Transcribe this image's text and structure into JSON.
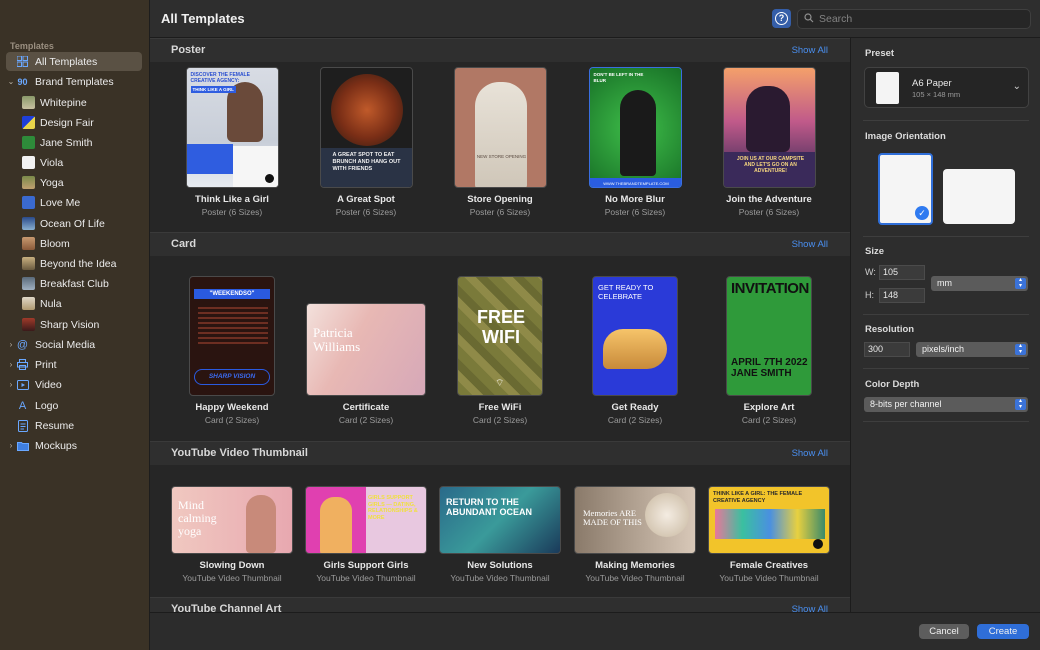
{
  "sidebar": {
    "group_header": "Templates",
    "items": [
      {
        "label": "All Templates",
        "icon": "grid-icon"
      },
      {
        "label": "Brand Templates",
        "icon": "brand-icon"
      },
      {
        "label": "Whitepine"
      },
      {
        "label": "Design Fair"
      },
      {
        "label": "Jane Smith"
      },
      {
        "label": "Viola"
      },
      {
        "label": "Yoga"
      },
      {
        "label": "Love Me"
      },
      {
        "label": "Ocean Of Life"
      },
      {
        "label": "Bloom"
      },
      {
        "label": "Beyond the Idea"
      },
      {
        "label": "Breakfast Club"
      },
      {
        "label": "Nula"
      },
      {
        "label": "Sharp Vision"
      },
      {
        "label": "Social Media",
        "icon": "at-icon"
      },
      {
        "label": "Print",
        "icon": "printer-icon"
      },
      {
        "label": "Video",
        "icon": "video-icon"
      },
      {
        "label": "Logo",
        "icon": "logo-icon"
      },
      {
        "label": "Resume",
        "icon": "document-icon"
      },
      {
        "label": "Mockups",
        "icon": "folder-icon"
      }
    ]
  },
  "header": {
    "title": "All Templates",
    "help_label": "?",
    "search_placeholder": "Search"
  },
  "sections": {
    "show_all": "Show All",
    "poster": {
      "title": "Poster",
      "items": [
        {
          "name": "Think Like a Girl",
          "sub": "Poster (6 Sizes)",
          "thumb_text": "DISCOVER THE FEMALE CREATIVE AGENCY:",
          "thumb_text2": "THINK LIKE A GIRL"
        },
        {
          "name": "A Great Spot",
          "sub": "Poster (6 Sizes)",
          "thumb_text": "A GREAT SPOT TO EAT BRUNCH AND HANG OUT WITH FRIENDS"
        },
        {
          "name": "Store Opening",
          "sub": "Poster (6 Sizes)",
          "thumb_text": "NEW STORE OPENING"
        },
        {
          "name": "No More Blur",
          "sub": "Poster (6 Sizes)",
          "thumb_text": "DON'T BE LEFT IN THE BLUR",
          "thumb_text2": "WWW.THEBRANDTEMPLATE.COM"
        },
        {
          "name": "Join the Adventure",
          "sub": "Poster (6 Sizes)",
          "thumb_text": "JOIN US AT OUR CAMPSITE AND LET'S GO ON AN ADVENTURE!"
        }
      ]
    },
    "card": {
      "title": "Card",
      "items": [
        {
          "name": "Happy Weekend",
          "sub": "Card (2 Sizes)",
          "thumb_text": "\"WEEKENDSO\"",
          "thumb_text2": "SHARP VISION"
        },
        {
          "name": "Certificate",
          "sub": "Card (2 Sizes)",
          "thumb_text": "Patricia Williams"
        },
        {
          "name": "Free WiFi",
          "sub": "Card (2 Sizes)",
          "thumb_text": "FREE WIFI"
        },
        {
          "name": "Get Ready",
          "sub": "Card (2 Sizes)",
          "thumb_text": "GET READY TO CELEBRATE"
        },
        {
          "name": "Explore Art",
          "sub": "Card (2 Sizes)",
          "thumb_text": "INVITATION",
          "thumb_text2": "APRIL 7TH 2022 JANE SMITH"
        }
      ]
    },
    "youtube": {
      "title": "YouTube Video Thumbnail",
      "items": [
        {
          "name": "Slowing Down",
          "sub": "YouTube Video Thumbnail",
          "thumb_text": "Mind calming yoga"
        },
        {
          "name": "Girls Support Girls",
          "sub": "YouTube Video Thumbnail",
          "thumb_text": "GIRLS SUPPORT GIRLS — DATING, RELATIONSHIPS & MORE"
        },
        {
          "name": "New Solutions",
          "sub": "YouTube Video Thumbnail",
          "thumb_text": "RETURN TO THE ABUNDANT OCEAN"
        },
        {
          "name": "Making Memories",
          "sub": "YouTube Video Thumbnail",
          "thumb_text": "Memories ARE MADE OF THIS"
        },
        {
          "name": "Female Creatives",
          "sub": "YouTube Video Thumbnail",
          "thumb_text": "THINK LIKE A GIRL: THE FEMALE CREATIVE AGENCY"
        }
      ]
    },
    "channel_art": {
      "title": "YouTube Channel Art"
    }
  },
  "inspector": {
    "preset_label": "Preset",
    "preset_name": "A6 Paper",
    "preset_dims": "105 × 148 mm",
    "orientation_label": "Image Orientation",
    "size_label": "Size",
    "w_label": "W:",
    "w_value": "105",
    "h_label": "H:",
    "h_value": "148",
    "unit": "mm",
    "resolution_label": "Resolution",
    "resolution_value": "300",
    "resolution_unit": "pixels/inch",
    "depth_label": "Color Depth",
    "depth_value": "8-bits per channel"
  },
  "footer": {
    "cancel": "Cancel",
    "create": "Create"
  },
  "colors": {
    "accent": "#2f6ed8",
    "link": "#4a8ff0",
    "sidebar_bg": "#3a3226"
  }
}
